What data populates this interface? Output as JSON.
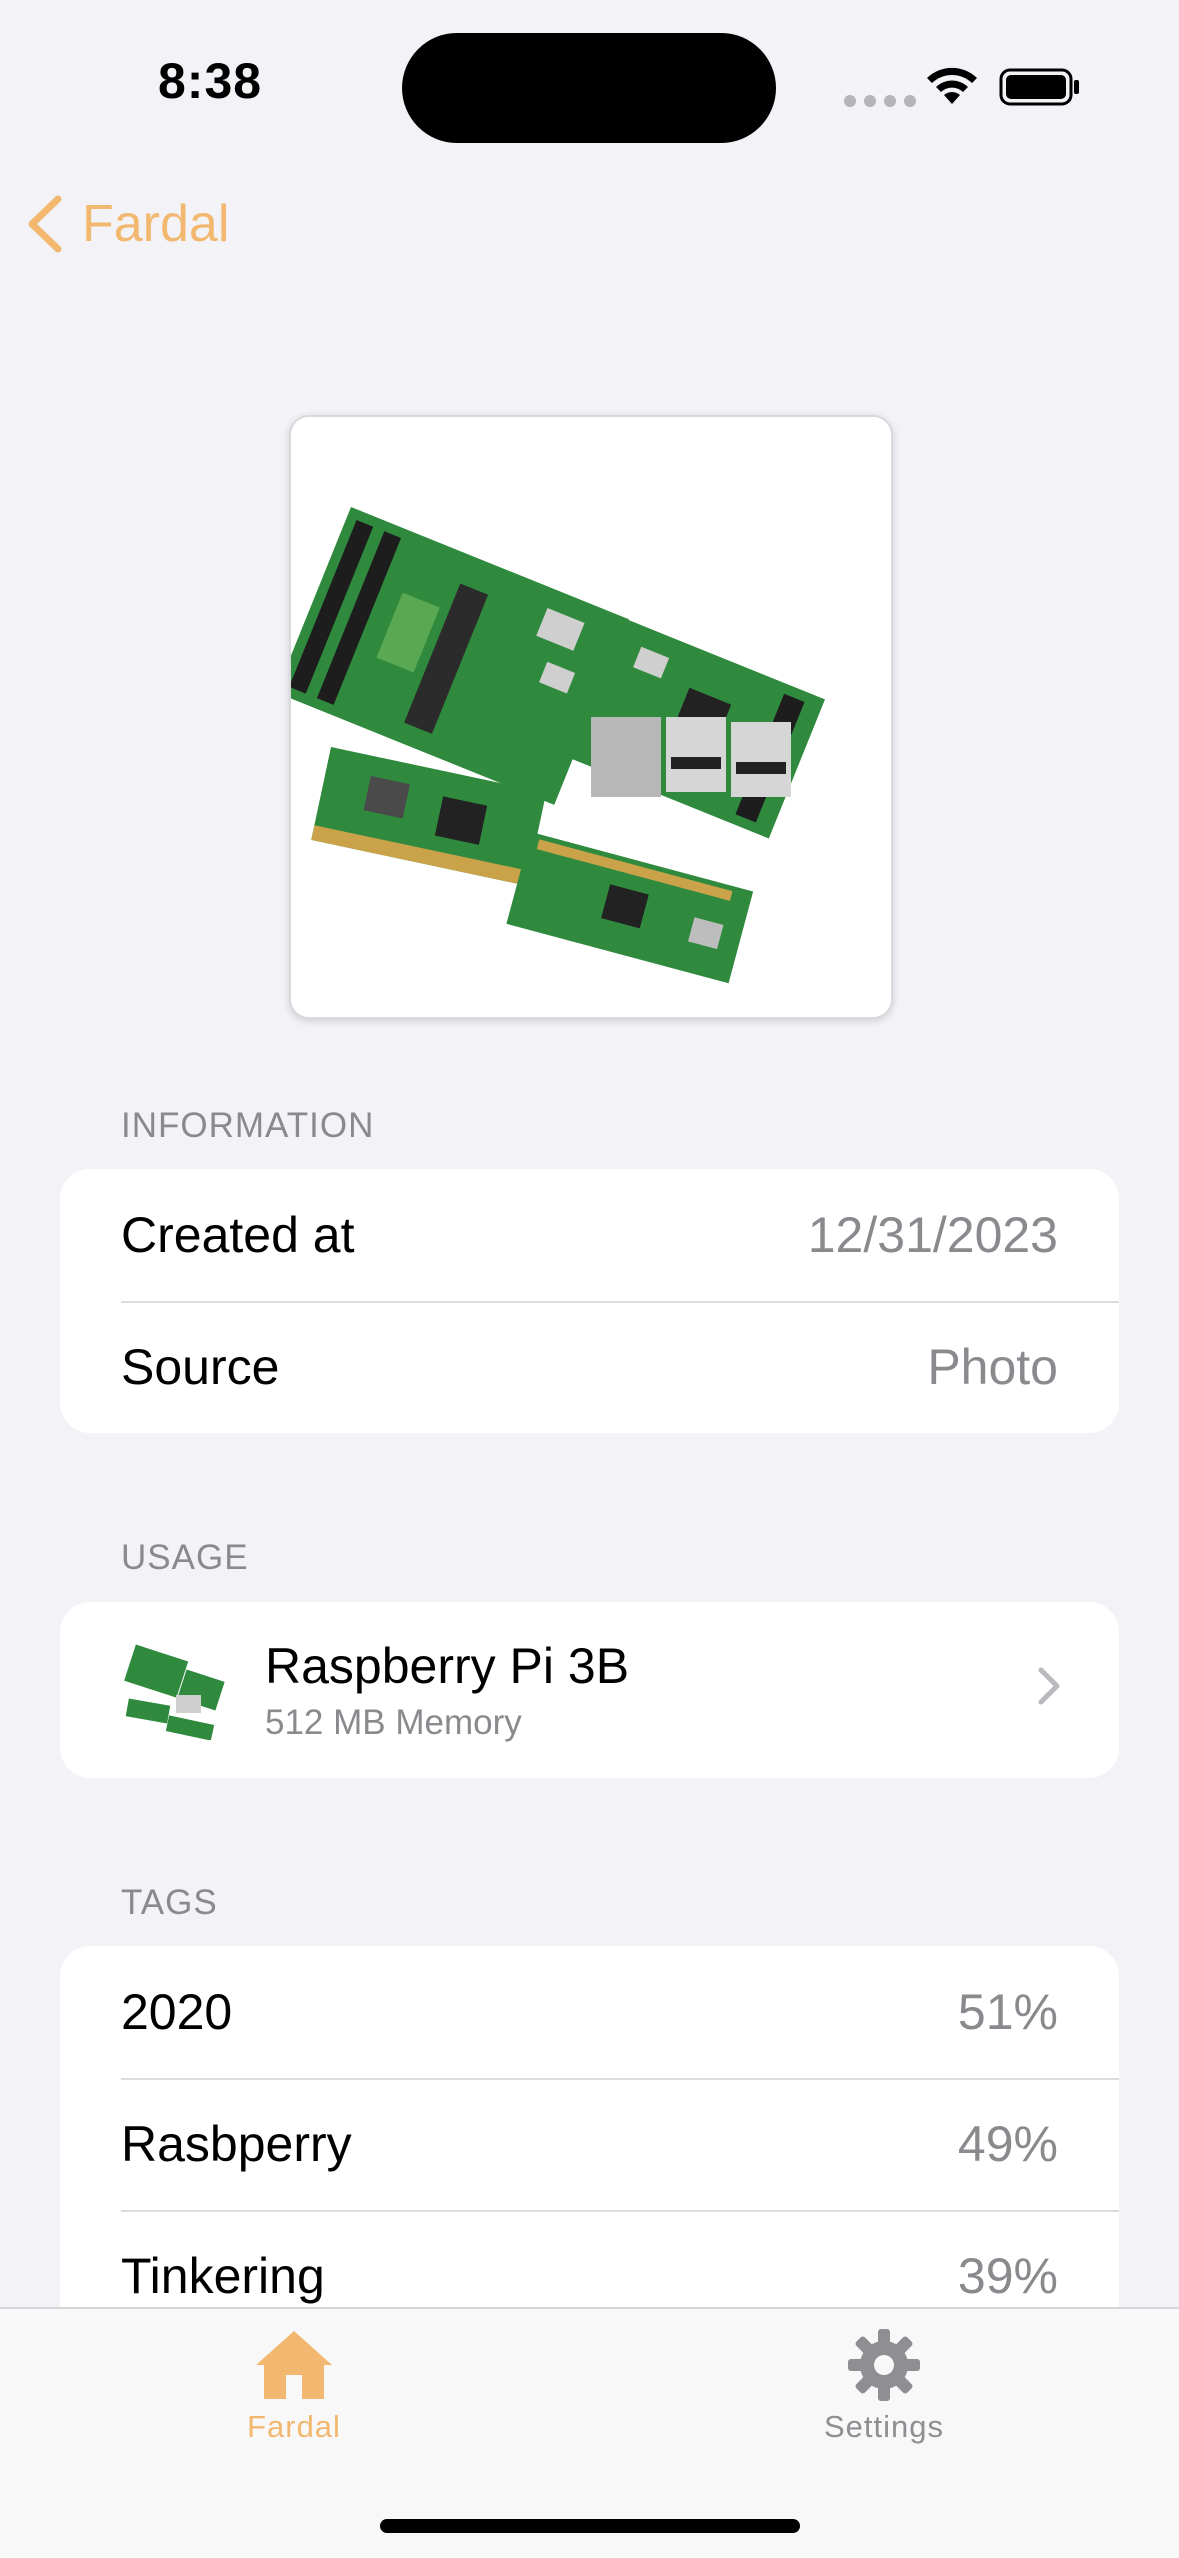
{
  "status_bar": {
    "time": "8:38"
  },
  "nav": {
    "back_label": "Fardal"
  },
  "sections": {
    "information": {
      "header": "INFORMATION",
      "rows": [
        {
          "label": "Created at",
          "value": "12/31/2023"
        },
        {
          "label": "Source",
          "value": "Photo"
        }
      ]
    },
    "usage": {
      "header": "USAGE",
      "item": {
        "title": "Raspberry Pi 3B",
        "subtitle": "512 MB Memory"
      }
    },
    "tags": {
      "header": "TAGS",
      "rows": [
        {
          "label": "2020",
          "value": "51%"
        },
        {
          "label": "Rasbperry",
          "value": "49%"
        },
        {
          "label": "Tinkering",
          "value": "39%"
        }
      ]
    }
  },
  "tabbar": {
    "tabs": [
      {
        "label": "Fardal",
        "active": true
      },
      {
        "label": "Settings",
        "active": false
      }
    ]
  },
  "colors": {
    "accent": "#f3b870",
    "inactive": "#8e8e93",
    "background": "#f2f2f7"
  }
}
